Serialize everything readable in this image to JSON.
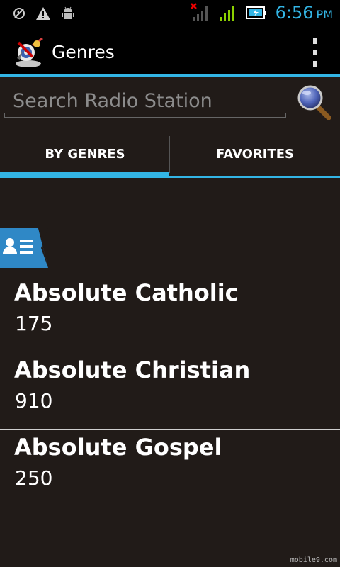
{
  "status_bar": {
    "time": "6:56",
    "ampm": "PM"
  },
  "action_bar": {
    "title": "Genres"
  },
  "search": {
    "placeholder": "Search Radio Station"
  },
  "tabs": [
    {
      "label": "BY GENRES",
      "selected": true
    },
    {
      "label": "FAVORITES",
      "selected": false
    }
  ],
  "genres": [
    {
      "name": "Absolute Catholic",
      "count": "175"
    },
    {
      "name": "Absolute Christian",
      "count": "910"
    },
    {
      "name": "Absolute Gospel",
      "count": "250"
    }
  ],
  "watermark": "mobile9.com",
  "colors": {
    "accent": "#33b5e5",
    "background": "#211b18"
  }
}
